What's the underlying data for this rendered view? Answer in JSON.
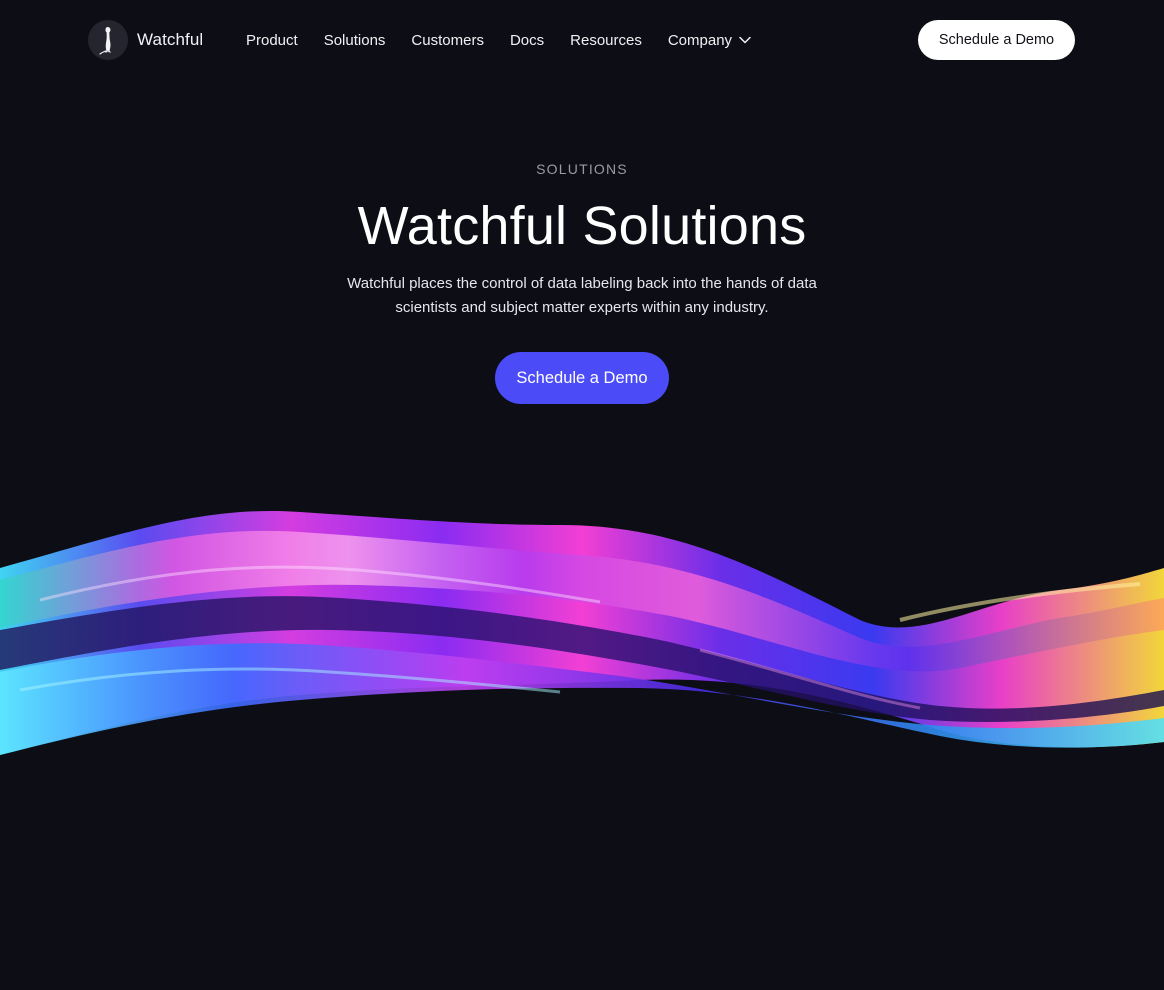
{
  "header": {
    "brand": "Watchful",
    "logo_icon": "meerkat-logo-icon",
    "nav": [
      {
        "label": "Product"
      },
      {
        "label": "Solutions"
      },
      {
        "label": "Customers"
      },
      {
        "label": "Docs"
      },
      {
        "label": "Resources"
      },
      {
        "label": "Company",
        "icon": "chevron-down-icon"
      }
    ],
    "cta_label": "Schedule a Demo"
  },
  "hero": {
    "eyebrow": "SOLUTIONS",
    "title": "Watchful Solutions",
    "subtitle": "Watchful places the control of data labeling back into the hands of data scientists and subject matter experts within any industry.",
    "cta_label": "Schedule a Demo"
  },
  "colors": {
    "background": "#0d0e15",
    "accent": "#4b4cf7",
    "header_cta_bg": "#ffffff"
  }
}
